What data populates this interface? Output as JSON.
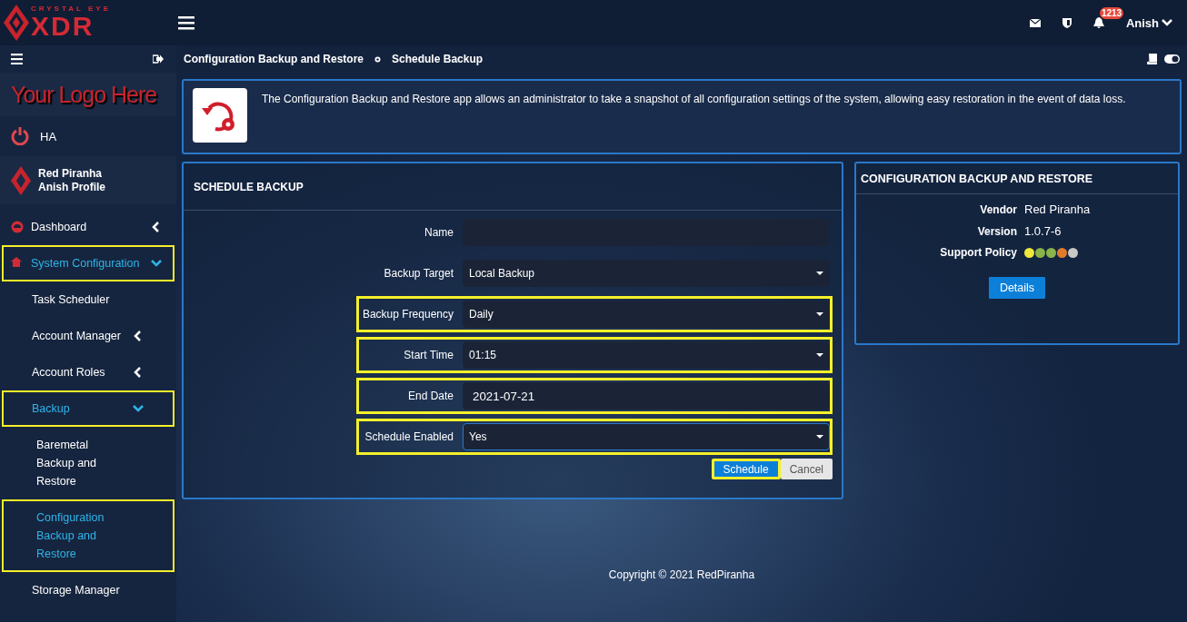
{
  "brand": {
    "tagline": "CRYSTAL EYE",
    "name": "XDR"
  },
  "topbar": {
    "notifications": "1213",
    "user": "Anish"
  },
  "sidebar": {
    "custom_logo": "Your Logo Here",
    "ha": "HA",
    "profile": {
      "company": "Red Piranha",
      "name": "Anish Profile"
    },
    "items": [
      {
        "label": "Dashboard",
        "expanded": false,
        "selected": false,
        "highlighted": false
      },
      {
        "label": "System Configuration",
        "expanded": true,
        "selected": true,
        "highlighted": true,
        "children": [
          {
            "label": "Task Scheduler",
            "selected": false,
            "highlighted": false
          },
          {
            "label": "Account Manager",
            "expanded": false,
            "selected": false,
            "highlighted": false
          },
          {
            "label": "Account Roles",
            "expanded": false,
            "selected": false,
            "highlighted": false
          },
          {
            "label": "Backup",
            "expanded": true,
            "selected": true,
            "highlighted": true,
            "children": [
              {
                "label": "Baremetal Backup and Restore",
                "selected": false,
                "highlighted": false
              },
              {
                "label": "Configuration Backup and Restore",
                "selected": true,
                "highlighted": true
              }
            ]
          },
          {
            "label": "Storage Manager",
            "selected": false,
            "highlighted": false
          }
        ]
      }
    ]
  },
  "breadcrumb": [
    "Configuration Backup and Restore",
    "Schedule Backup"
  ],
  "intro": "The Configuration Backup and Restore app allows an administrator to take a snapshot of all configuration settings of the system, allowing easy restoration in the event of data loss.",
  "form": {
    "title": "SCHEDULE BACKUP",
    "fields": [
      {
        "label": "Name",
        "kind": "text",
        "highlighted": false,
        "focused": false
      },
      {
        "label": "Backup Target",
        "kind": "select",
        "value": "Local Backup",
        "highlighted": false,
        "focused": false
      },
      {
        "label": "Backup Frequency",
        "kind": "select",
        "value": "Daily",
        "highlighted": true,
        "focused": false
      },
      {
        "label": "Start Time",
        "kind": "select",
        "value": "01:15",
        "highlighted": true,
        "focused": false
      },
      {
        "label": "End Date",
        "kind": "date",
        "value": "2021-07-21",
        "highlighted": true,
        "focused": false
      },
      {
        "label": "Schedule Enabled",
        "kind": "select",
        "value": "Yes",
        "highlighted": true,
        "focused": true
      }
    ],
    "buttons": [
      {
        "label": "Schedule",
        "kind": "primary",
        "highlighted": true
      },
      {
        "label": "Cancel",
        "kind": "secondary",
        "highlighted": false
      }
    ]
  },
  "app_info": {
    "title": "CONFIGURATION BACKUP AND RESTORE",
    "rows": [
      {
        "label": "Vendor",
        "value": "Red Piranha"
      },
      {
        "label": "Version",
        "value": "1.0.7-6"
      }
    ],
    "support_label": "Support Policy",
    "support_dots": [
      {
        "color": "#f0e83a"
      },
      {
        "color": "#8ab34a"
      },
      {
        "color": "#8ab34a"
      },
      {
        "color": "#e07b2c"
      },
      {
        "color": "#c8c8c8"
      }
    ],
    "button": "Details"
  },
  "footer": "Copyright © 2021 RedPiranha"
}
